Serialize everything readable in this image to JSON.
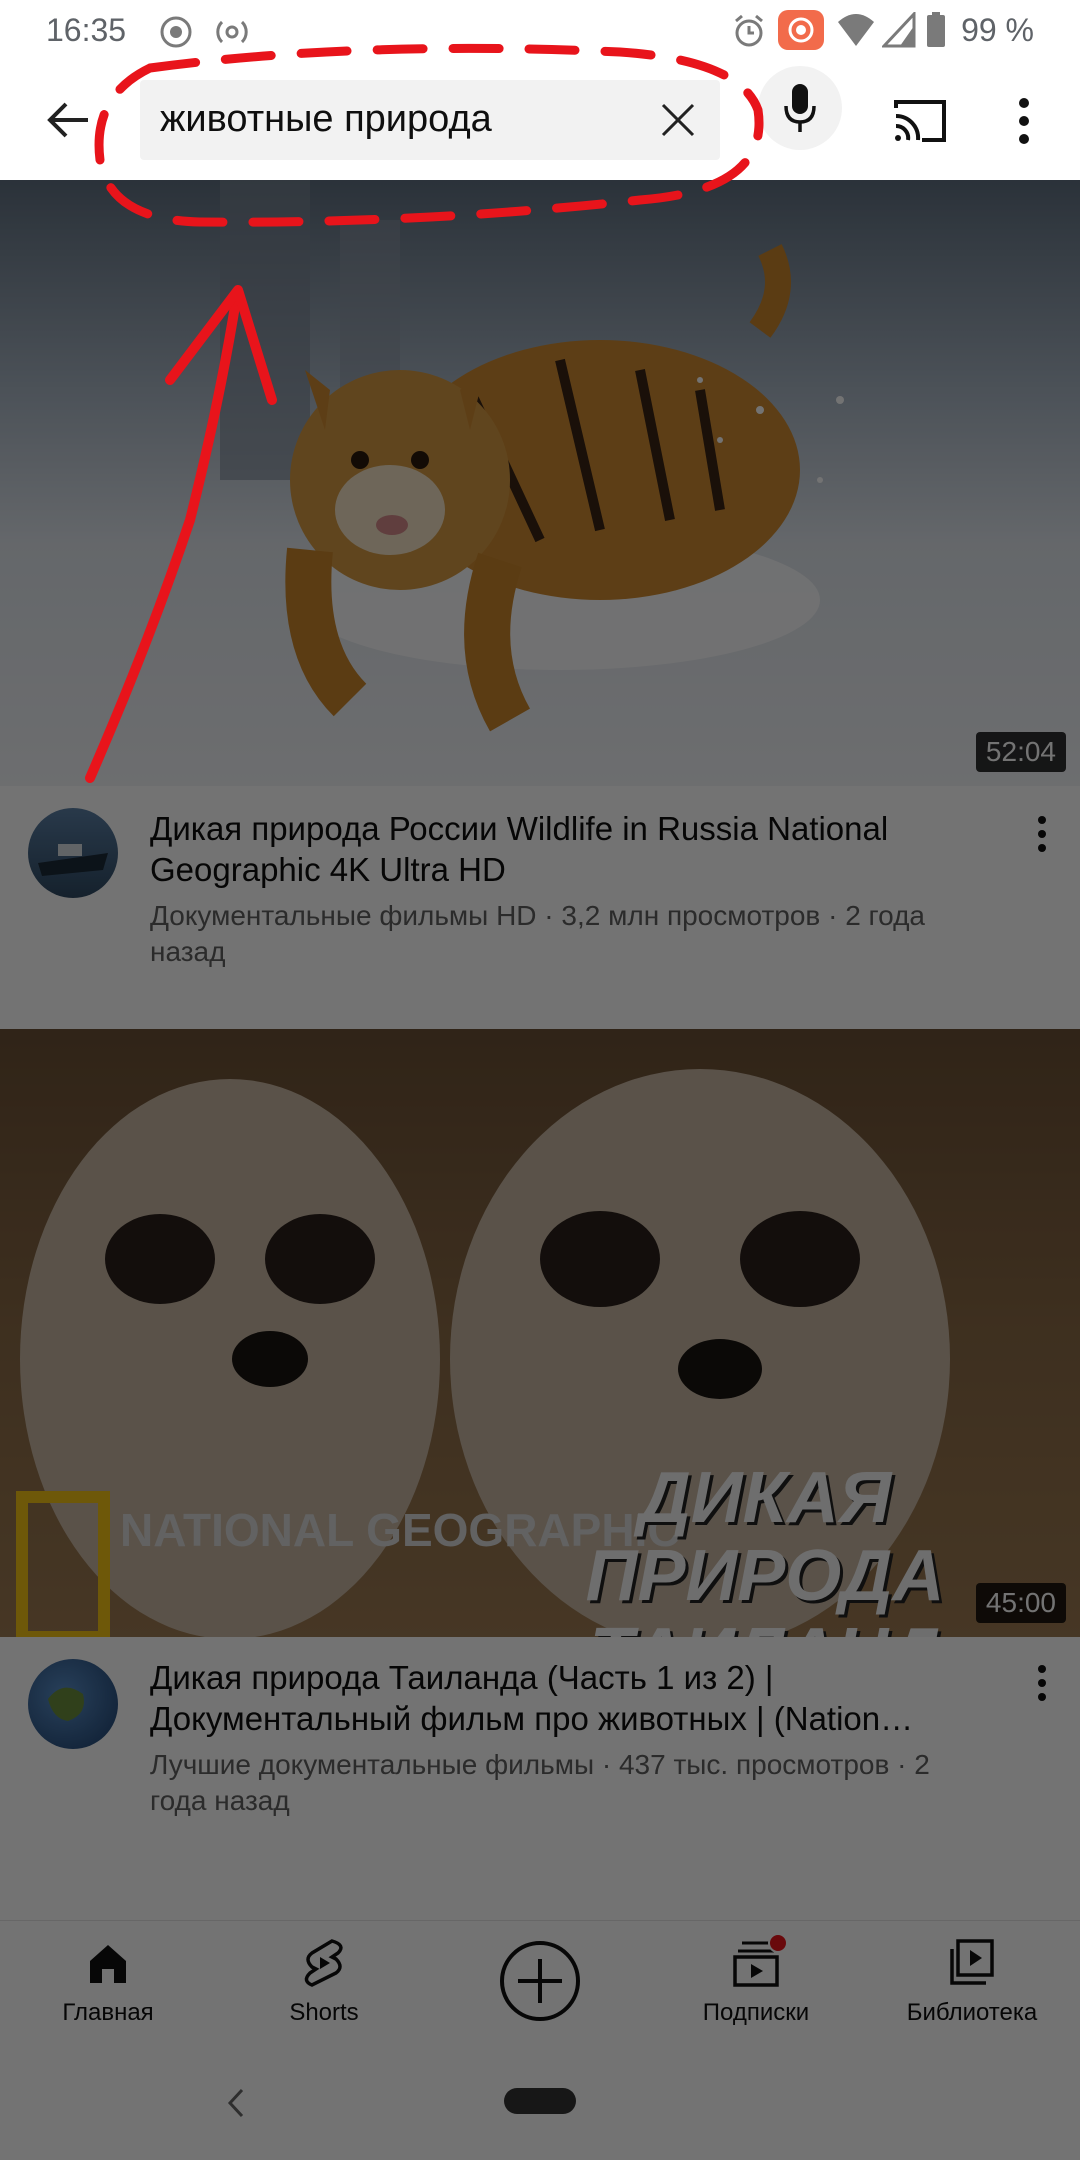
{
  "status_bar": {
    "time": "16:35",
    "battery": "99 %"
  },
  "search": {
    "query": "животные природа"
  },
  "videos": [
    {
      "title": "Дикая природа  России   Wildlife in Russia National Geographic 4K Ultra HD",
      "channel_line": "Документальные фильмы HD · 3,2 млн просмотров · 2 года назад",
      "duration": "52:04"
    },
    {
      "title": "Дикая природа Таиланда (Часть 1 из 2) | Документальный фильм про животных | (Nation…",
      "channel_line": "Лучшие документальные фильмы · 437 тыс. просмотров · 2 года назад",
      "duration": "45:00",
      "thumb_logo": "NATIONAL GEOGRAPHIC",
      "thumb_text": "ДИКАЯ ПРИРОДА ТАИЛАНД"
    }
  ],
  "bottom_nav": {
    "home": "Главная",
    "shorts": "Shorts",
    "subscriptions": "Подписки",
    "library": "Библиотека"
  },
  "colors": {
    "annotation": "#e8141b",
    "notification_dot": "#e8141b",
    "brand_red": "#ff0000"
  }
}
